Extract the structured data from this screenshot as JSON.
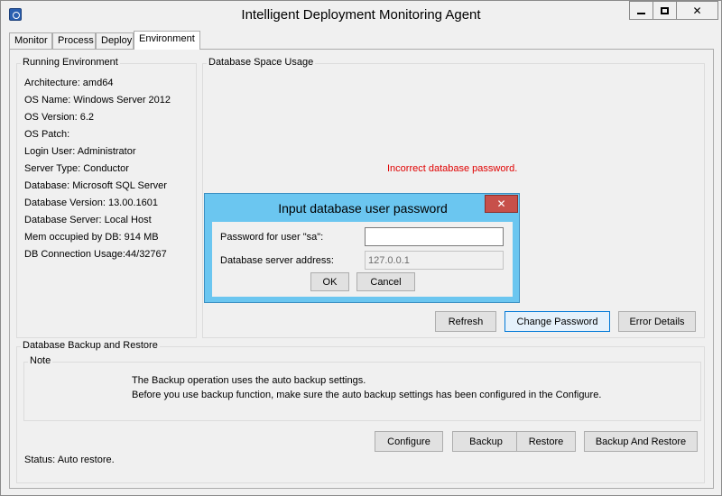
{
  "window": {
    "title": "Intelligent Deployment Monitoring Agent",
    "icon": "app-monitor-icon"
  },
  "tabs": [
    {
      "label": "Monitor",
      "active": false
    },
    {
      "label": "Process",
      "active": false
    },
    {
      "label": "Deploy",
      "active": false
    },
    {
      "label": "Environment",
      "active": true
    }
  ],
  "running_environment": {
    "title": "Running Environment",
    "lines": [
      "Architecture: amd64",
      "OS Name: Windows Server 2012",
      "OS Version: 6.2",
      "OS Patch:",
      "Login User: Administrator",
      "Server Type: Conductor",
      "Database: Microsoft SQL Server",
      "Database Version: 13.00.1601",
      "Database Server: Local Host",
      "Mem occupied by DB: 914 MB",
      "DB Connection Usage:44/32767"
    ]
  },
  "space_usage": {
    "title": "Database Space Usage",
    "error_message": "Incorrect database password.",
    "buttons": {
      "refresh": "Refresh",
      "change_password": "Change Password",
      "error_details": "Error Details"
    }
  },
  "backup_restore": {
    "title": "Database Backup and Restore",
    "note_title": "Note",
    "note_lines": [
      "The Backup operation uses the auto backup settings.",
      "Before you use backup function, make sure the auto backup settings has been configured in the Configure."
    ],
    "buttons": {
      "configure": "Configure",
      "backup": "Backup",
      "restore": "Restore",
      "backup_and_restore": "Backup And Restore"
    },
    "status": "Status: Auto restore."
  },
  "password_dialog": {
    "title": "Input database user password",
    "password_label": "Password for user \"sa\":",
    "password_value": "",
    "address_label": "Database server address:",
    "address_value": "127.0.0.1",
    "ok_label": "OK",
    "cancel_label": "Cancel"
  },
  "colors": {
    "dialog_frame": "#6bc6f0",
    "error_text": "#e00000",
    "close_button": "#c7504a",
    "focus_border": "#0078d7"
  }
}
